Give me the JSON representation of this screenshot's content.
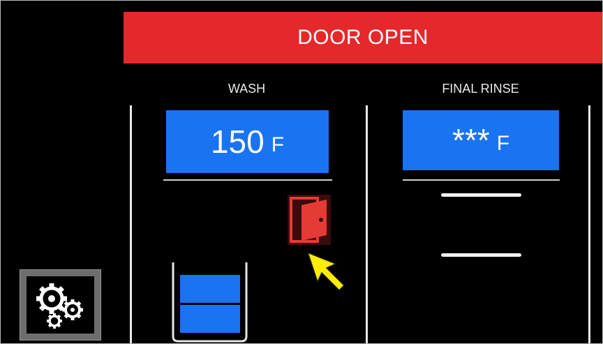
{
  "banner": {
    "text": "DOOR OPEN",
    "color": "#e5282b"
  },
  "wash": {
    "title": "WASH",
    "temperature": "150",
    "unit": "F"
  },
  "final_rinse": {
    "title": "FINAL RINSE",
    "temperature": "***",
    "unit": "F"
  },
  "icons": {
    "door": "door-open-icon",
    "settings": "gears-icon",
    "cursor": "pointer-cursor-icon",
    "tank": "tank-level-icon"
  },
  "colors": {
    "accent_blue": "#1a73f0",
    "alarm_red": "#e5282b",
    "door_red": "#e53a36",
    "cursor_yellow": "#ffee00"
  }
}
